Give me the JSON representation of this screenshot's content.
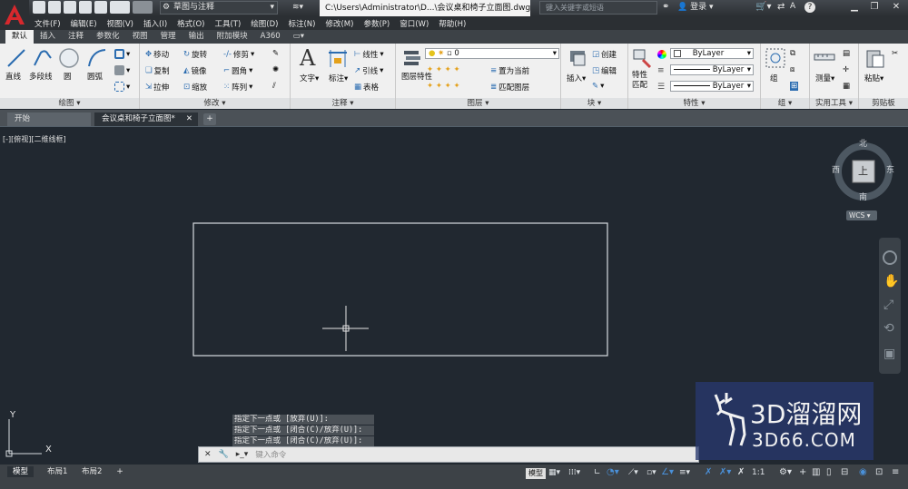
{
  "app": {
    "workspace": "草图与注释",
    "document_path": "C:\\Users\\Administrator\\D...\\会议桌和椅子立面图.dwg",
    "search_placeholder": "键入关键字或短语",
    "login_label": "登录"
  },
  "menu": [
    "文件(F)",
    "编辑(E)",
    "视图(V)",
    "插入(I)",
    "格式(O)",
    "工具(T)",
    "绘图(D)",
    "标注(N)",
    "修改(M)",
    "参数(P)",
    "窗口(W)",
    "帮助(H)"
  ],
  "ribbon_tabs": [
    "默认",
    "插入",
    "注释",
    "参数化",
    "视图",
    "管理",
    "输出",
    "附加模块",
    "A360"
  ],
  "ribbon": {
    "draw": {
      "title": "绘图",
      "line": "直线",
      "polyline": "多段线",
      "circle": "圆",
      "arc": "圆弧"
    },
    "modify": {
      "title": "修改",
      "move": "移动",
      "rotate": "旋转",
      "trim": "修剪",
      "copy": "复制",
      "mirror": "镜像",
      "fillet": "圆角",
      "stretch": "拉伸",
      "scale": "缩放",
      "array": "阵列"
    },
    "annotation": {
      "title": "注释",
      "text": "文字",
      "dimension": "标注",
      "linear": "线性",
      "leader": "引线",
      "table": "表格"
    },
    "layers": {
      "title": "图层",
      "layer_props": "图层特性",
      "layer_value": "0",
      "set_current": "置为当前",
      "match_layer": "匹配图层"
    },
    "block": {
      "title": "块",
      "insert": "插入",
      "create": "创建",
      "edit": "编辑"
    },
    "properties": {
      "title": "特性",
      "match": "特性匹配",
      "color": "ByLayer",
      "linetype": "ByLayer",
      "lineweight": "ByLayer"
    },
    "groups": {
      "title": "组",
      "group": "组"
    },
    "utilities": {
      "title": "实用工具",
      "measure": "测量"
    },
    "clipboard": {
      "title": "剪贴板",
      "paste": "粘贴"
    }
  },
  "file_tabs": [
    "开始",
    "会议桌和椅子立面图*"
  ],
  "drawing": {
    "view_label": "[-][俯视][二维线框]",
    "compass": {
      "north": "北",
      "south": "南",
      "east": "东",
      "west": "西",
      "top": "上"
    },
    "wcs": "WCS",
    "axis_x": "X",
    "axis_y": "Y"
  },
  "command": {
    "history": [
      "指定下一点或 [放弃(U)]:",
      "指定下一点或 [闭合(C)/放弃(U)]:",
      "指定下一点或 [闭合(C)/放弃(U)]:"
    ],
    "placeholder": "键入命令"
  },
  "layout_tabs": [
    "模型",
    "布局1",
    "布局2"
  ],
  "status": {
    "model": "模型",
    "scale": "1:1"
  },
  "watermark": {
    "title": "3D溜溜网",
    "url": "3D66.COM"
  }
}
